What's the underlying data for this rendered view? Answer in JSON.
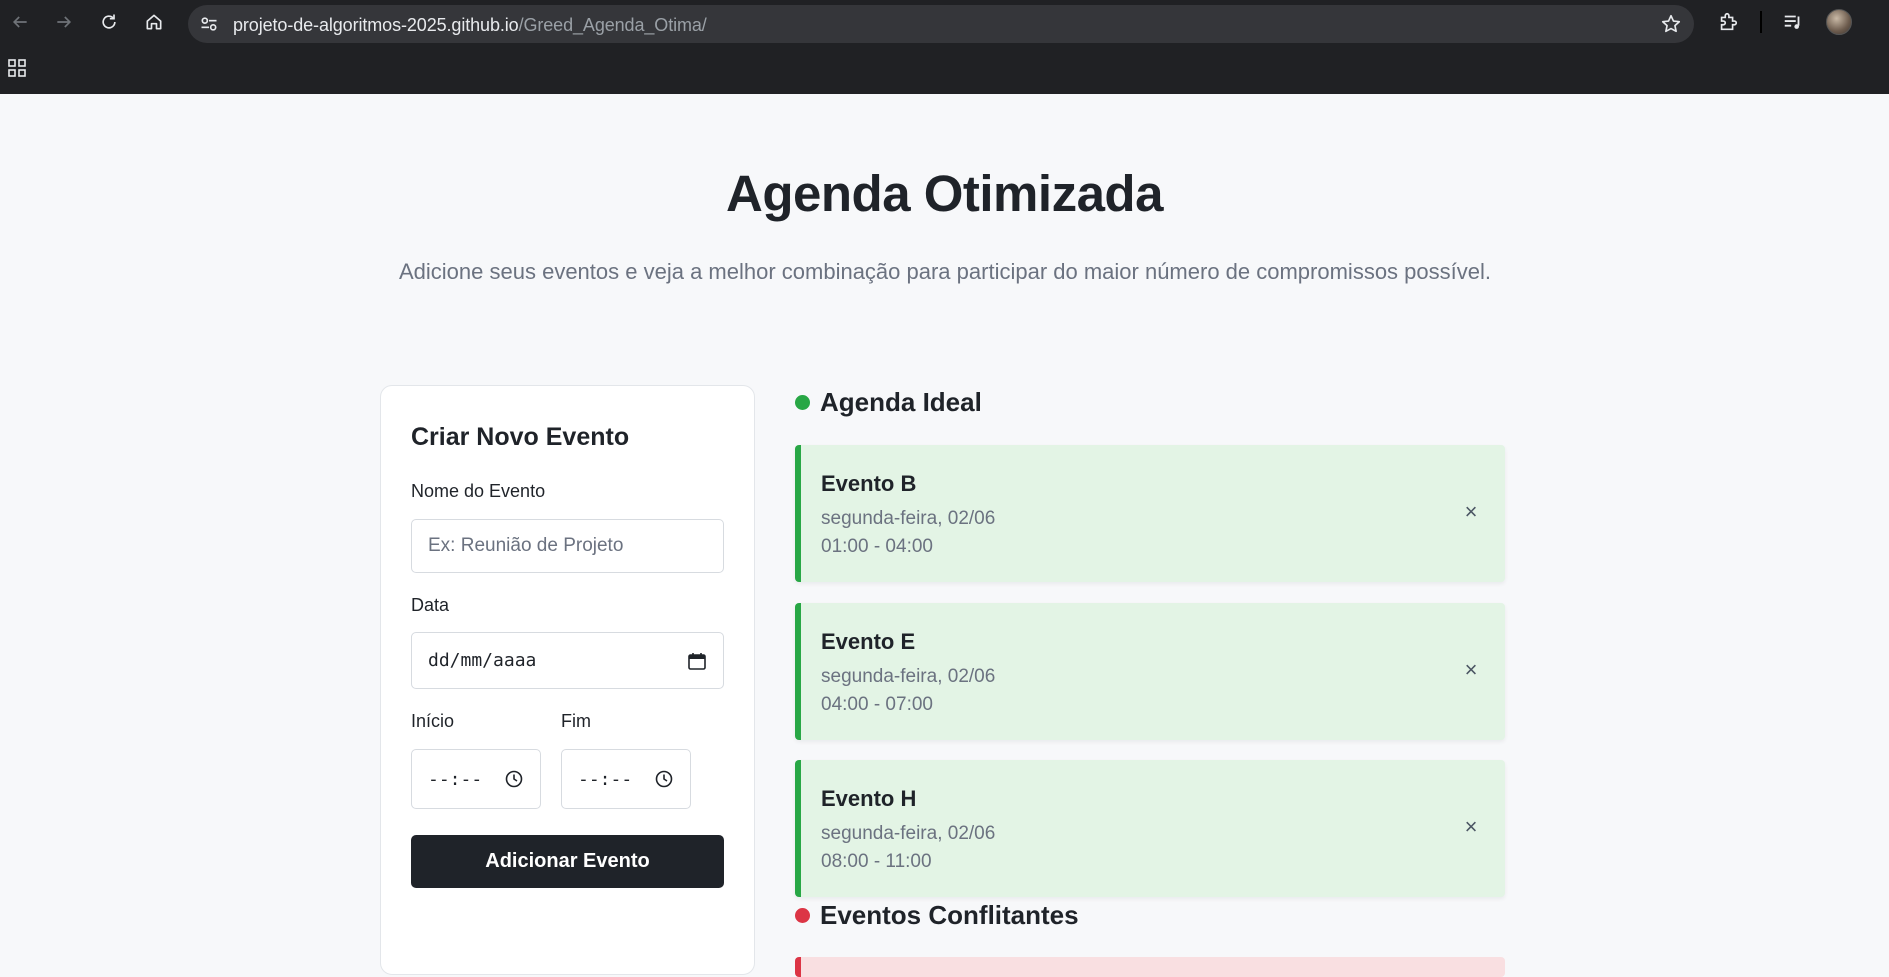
{
  "browser": {
    "url_host": "projeto-de-algoritmos-2025.github.io",
    "url_path": "/Greed_Agenda_Otima/"
  },
  "page": {
    "title": "Agenda Otimizada",
    "subtitle": "Adicione seus eventos e veja a melhor combinação para participar do maior número de compromissos possível."
  },
  "form": {
    "title": "Criar Novo Evento",
    "name_label": "Nome do Evento",
    "name_placeholder": "Ex: Reunião de Projeto",
    "date_label": "Data",
    "date_value": "dd/mm/aaaa",
    "start_label": "Início",
    "start_value": "--:--",
    "end_label": "Fim",
    "end_value": "--:--",
    "submit_label": "Adicionar Evento"
  },
  "ideal": {
    "heading": "Agenda Ideal",
    "accent": "#28a745",
    "events": [
      {
        "name": "Evento B",
        "date": "segunda-feira, 02/06",
        "time": "01:00 - 04:00",
        "remove": "×"
      },
      {
        "name": "Evento E",
        "date": "segunda-feira, 02/06",
        "time": "04:00 - 07:00",
        "remove": "×"
      },
      {
        "name": "Evento H",
        "date": "segunda-feira, 02/06",
        "time": "08:00 - 11:00",
        "remove": "×"
      }
    ]
  },
  "conflicts": {
    "heading": "Eventos Conflitantes",
    "accent": "#dc3545"
  }
}
